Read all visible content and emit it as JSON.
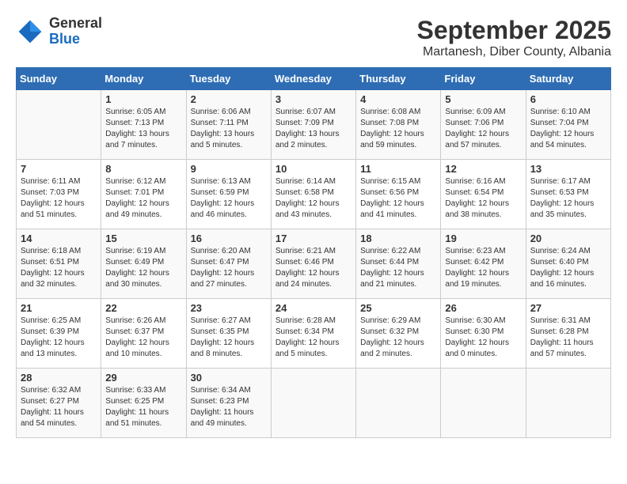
{
  "header": {
    "logo_general": "General",
    "logo_blue": "Blue",
    "month": "September 2025",
    "location": "Martanesh, Diber County, Albania"
  },
  "weekdays": [
    "Sunday",
    "Monday",
    "Tuesday",
    "Wednesday",
    "Thursday",
    "Friday",
    "Saturday"
  ],
  "weeks": [
    [
      {
        "day": "",
        "info": ""
      },
      {
        "day": "1",
        "info": "Sunrise: 6:05 AM\nSunset: 7:13 PM\nDaylight: 13 hours\nand 7 minutes."
      },
      {
        "day": "2",
        "info": "Sunrise: 6:06 AM\nSunset: 7:11 PM\nDaylight: 13 hours\nand 5 minutes."
      },
      {
        "day": "3",
        "info": "Sunrise: 6:07 AM\nSunset: 7:09 PM\nDaylight: 13 hours\nand 2 minutes."
      },
      {
        "day": "4",
        "info": "Sunrise: 6:08 AM\nSunset: 7:08 PM\nDaylight: 12 hours\nand 59 minutes."
      },
      {
        "day": "5",
        "info": "Sunrise: 6:09 AM\nSunset: 7:06 PM\nDaylight: 12 hours\nand 57 minutes."
      },
      {
        "day": "6",
        "info": "Sunrise: 6:10 AM\nSunset: 7:04 PM\nDaylight: 12 hours\nand 54 minutes."
      }
    ],
    [
      {
        "day": "7",
        "info": "Sunrise: 6:11 AM\nSunset: 7:03 PM\nDaylight: 12 hours\nand 51 minutes."
      },
      {
        "day": "8",
        "info": "Sunrise: 6:12 AM\nSunset: 7:01 PM\nDaylight: 12 hours\nand 49 minutes."
      },
      {
        "day": "9",
        "info": "Sunrise: 6:13 AM\nSunset: 6:59 PM\nDaylight: 12 hours\nand 46 minutes."
      },
      {
        "day": "10",
        "info": "Sunrise: 6:14 AM\nSunset: 6:58 PM\nDaylight: 12 hours\nand 43 minutes."
      },
      {
        "day": "11",
        "info": "Sunrise: 6:15 AM\nSunset: 6:56 PM\nDaylight: 12 hours\nand 41 minutes."
      },
      {
        "day": "12",
        "info": "Sunrise: 6:16 AM\nSunset: 6:54 PM\nDaylight: 12 hours\nand 38 minutes."
      },
      {
        "day": "13",
        "info": "Sunrise: 6:17 AM\nSunset: 6:53 PM\nDaylight: 12 hours\nand 35 minutes."
      }
    ],
    [
      {
        "day": "14",
        "info": "Sunrise: 6:18 AM\nSunset: 6:51 PM\nDaylight: 12 hours\nand 32 minutes."
      },
      {
        "day": "15",
        "info": "Sunrise: 6:19 AM\nSunset: 6:49 PM\nDaylight: 12 hours\nand 30 minutes."
      },
      {
        "day": "16",
        "info": "Sunrise: 6:20 AM\nSunset: 6:47 PM\nDaylight: 12 hours\nand 27 minutes."
      },
      {
        "day": "17",
        "info": "Sunrise: 6:21 AM\nSunset: 6:46 PM\nDaylight: 12 hours\nand 24 minutes."
      },
      {
        "day": "18",
        "info": "Sunrise: 6:22 AM\nSunset: 6:44 PM\nDaylight: 12 hours\nand 21 minutes."
      },
      {
        "day": "19",
        "info": "Sunrise: 6:23 AM\nSunset: 6:42 PM\nDaylight: 12 hours\nand 19 minutes."
      },
      {
        "day": "20",
        "info": "Sunrise: 6:24 AM\nSunset: 6:40 PM\nDaylight: 12 hours\nand 16 minutes."
      }
    ],
    [
      {
        "day": "21",
        "info": "Sunrise: 6:25 AM\nSunset: 6:39 PM\nDaylight: 12 hours\nand 13 minutes."
      },
      {
        "day": "22",
        "info": "Sunrise: 6:26 AM\nSunset: 6:37 PM\nDaylight: 12 hours\nand 10 minutes."
      },
      {
        "day": "23",
        "info": "Sunrise: 6:27 AM\nSunset: 6:35 PM\nDaylight: 12 hours\nand 8 minutes."
      },
      {
        "day": "24",
        "info": "Sunrise: 6:28 AM\nSunset: 6:34 PM\nDaylight: 12 hours\nand 5 minutes."
      },
      {
        "day": "25",
        "info": "Sunrise: 6:29 AM\nSunset: 6:32 PM\nDaylight: 12 hours\nand 2 minutes."
      },
      {
        "day": "26",
        "info": "Sunrise: 6:30 AM\nSunset: 6:30 PM\nDaylight: 12 hours\nand 0 minutes."
      },
      {
        "day": "27",
        "info": "Sunrise: 6:31 AM\nSunset: 6:28 PM\nDaylight: 11 hours\nand 57 minutes."
      }
    ],
    [
      {
        "day": "28",
        "info": "Sunrise: 6:32 AM\nSunset: 6:27 PM\nDaylight: 11 hours\nand 54 minutes."
      },
      {
        "day": "29",
        "info": "Sunrise: 6:33 AM\nSunset: 6:25 PM\nDaylight: 11 hours\nand 51 minutes."
      },
      {
        "day": "30",
        "info": "Sunrise: 6:34 AM\nSunset: 6:23 PM\nDaylight: 11 hours\nand 49 minutes."
      },
      {
        "day": "",
        "info": ""
      },
      {
        "day": "",
        "info": ""
      },
      {
        "day": "",
        "info": ""
      },
      {
        "day": "",
        "info": ""
      }
    ]
  ]
}
